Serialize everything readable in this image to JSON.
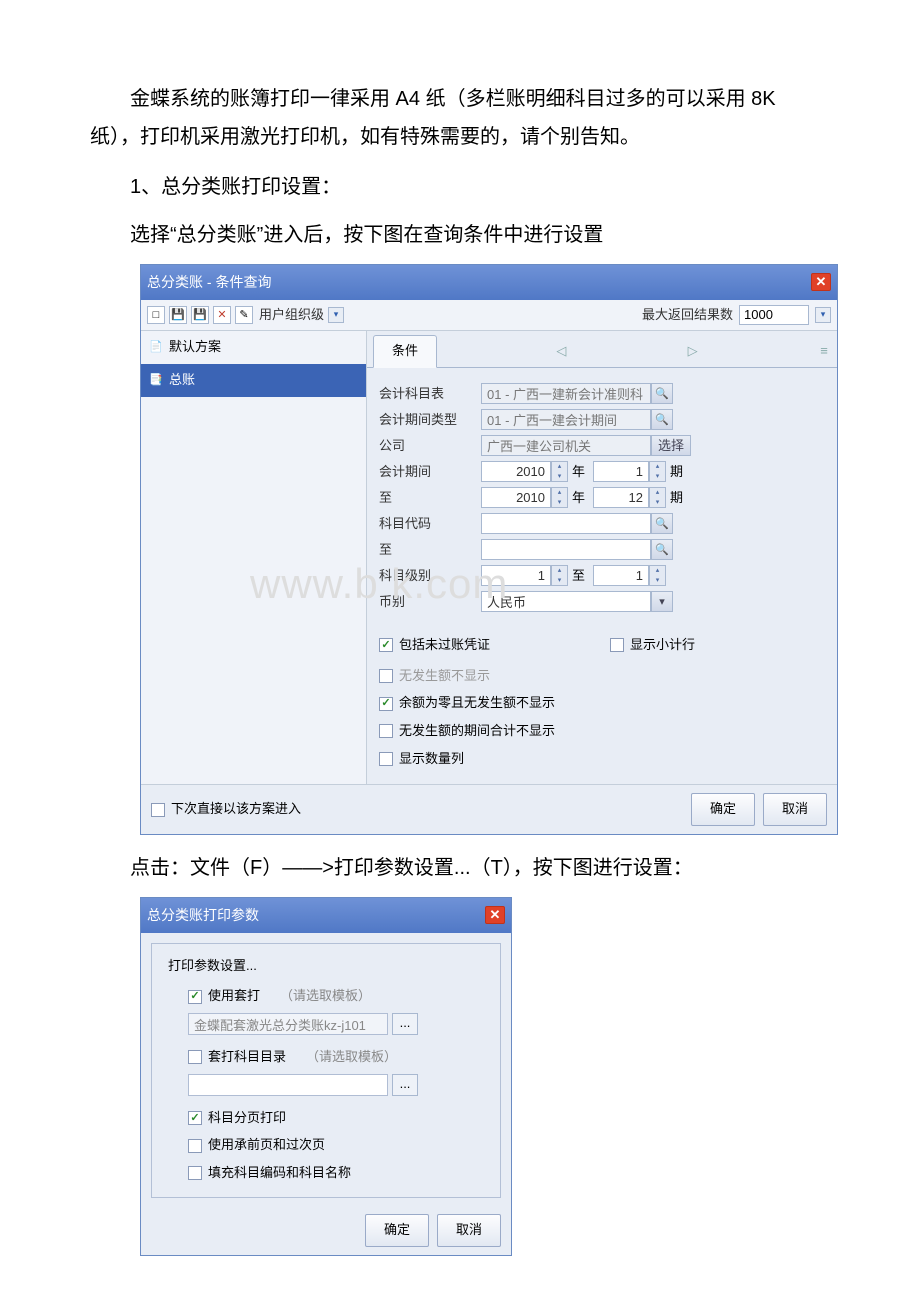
{
  "paragraph1": "金蝶系统的账簿打印一律采用 A4 纸（多栏账明细科目过多的可以采用 8K 纸），打印机采用激光打印机，如有特殊需要的，请个别告知。",
  "numbered1": "1、总分类账打印设置：",
  "paragraph2": "选择“总分类账”进入后，按下图在查询条件中进行设置",
  "paragraph3": "点击：文件（F）——>打印参数设置...（T），按下图进行设置：",
  "watermark": "www.b    k.com",
  "dlg1": {
    "title": "总分类账 - 条件查询",
    "toolbar": {
      "usergroup_label": "用户组织级",
      "max_label": "最大返回结果数",
      "max_value": "1000"
    },
    "sidebar": {
      "items": [
        {
          "icon": "📄",
          "label": "默认方案",
          "selected": false
        },
        {
          "icon": "📑",
          "label": "总账",
          "selected": true
        }
      ]
    },
    "tab_label": "条件",
    "form": {
      "rows": [
        {
          "label": "会计科目表",
          "value": "01 - 广西一建新会计准则科",
          "type": "lookup"
        },
        {
          "label": "会计期间类型",
          "value": "01 - 广西一建会计期间",
          "type": "lookup"
        },
        {
          "label": "公司",
          "value": "广西一建公司机关",
          "type": "select"
        }
      ],
      "period_from_label": "会计期间",
      "period_to_label": "至",
      "year_from": "2010",
      "period_from": "1",
      "year_to": "2010",
      "period_to": "12",
      "year_unit": "年",
      "period_unit": "期",
      "code_from_label": "科目代码",
      "code_to_label": "至",
      "level_label": "科目级别",
      "level_from": "1",
      "level_to": "1",
      "level_unit": "至",
      "currency_label": "币别",
      "currency_value": "人民币"
    },
    "checks": {
      "c1": "包括未过账凭证",
      "c2": "显示小计行",
      "c3": "无发生额不显示",
      "c4": "余额为零且无发生额不显示",
      "c5": "无发生额的期间合计不显示",
      "c6": "显示数量列"
    },
    "footer": {
      "remember": "下次直接以该方案进入",
      "ok": "确定",
      "cancel": "取消"
    }
  },
  "dlg2": {
    "title": "总分类账打印参数",
    "legend": "打印参数设置...",
    "row1": {
      "label": "使用套打",
      "hint": "（请选取模板）",
      "checked": true
    },
    "template1": "金蝶配套激光总分类账kz-j101",
    "row2": {
      "label": "套打科目目录",
      "hint": "（请选取模板）",
      "checked": false
    },
    "c1": "科目分页打印",
    "c2": "使用承前页和过次页",
    "c3": "填充科目编码和科目名称",
    "ok": "确定",
    "cancel": "取消"
  }
}
